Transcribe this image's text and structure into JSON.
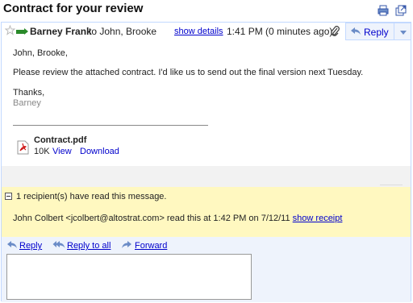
{
  "subject": "Contract for your review",
  "toolbar": {
    "print_icon": "print-icon",
    "popout_icon": "new-window-icon"
  },
  "message": {
    "sender": "Barney Frank",
    "recipients": "to John, Brooke",
    "show_details": "show details",
    "time": "1:41 PM (0 minutes ago)",
    "reply_label": "Reply",
    "greeting": "John, Brooke,",
    "body": "Please review the attached contract. I'd like us to send out the final version next Tuesday.",
    "closing": "Thanks,",
    "signature": "Barney"
  },
  "attachment": {
    "name": "Contract.pdf",
    "size": "10K",
    "view": "View",
    "download": "Download"
  },
  "receipt": {
    "header": "1 recipient(s) have read this message.",
    "detail": "John Colbert <jcolbert@altostrat.com> read this at 1:42 PM on 7/12/11",
    "link": "show receipt"
  },
  "actions": {
    "reply": "Reply",
    "reply_all": "Reply to all",
    "forward": "Forward"
  },
  "colors": {
    "accent": "#0000cc",
    "receipt_bg": "#fff8c0",
    "action_bg": "#eef3fc",
    "presence": "#2a8a2a"
  }
}
